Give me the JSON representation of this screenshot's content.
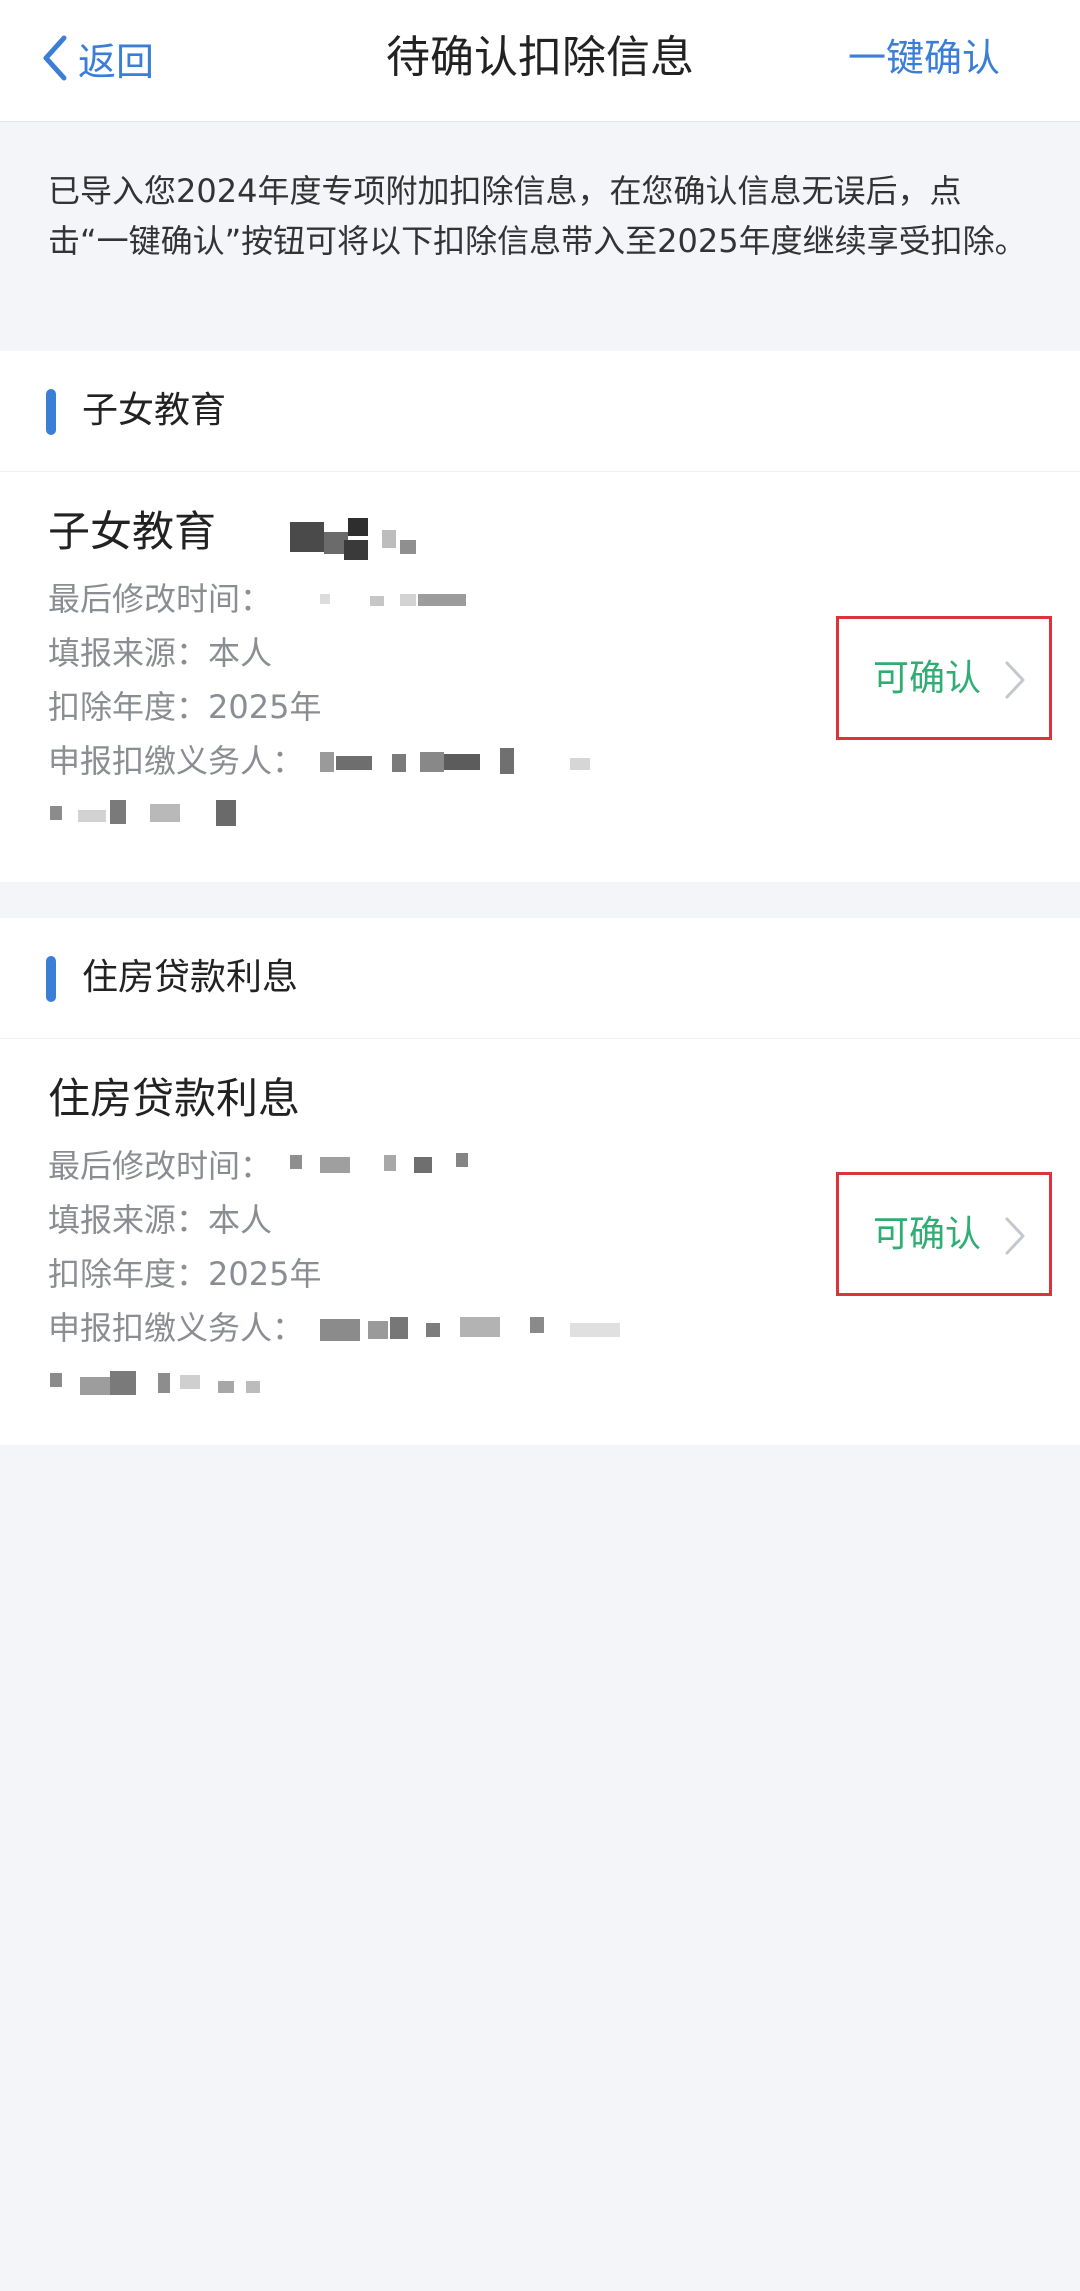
{
  "nav": {
    "back_label": "返回",
    "title": "待确认扣除信息",
    "confirm_all_label": "一键确认"
  },
  "notice": "已导入您2024年度专项附加扣除信息，在您确认信息无误后，点击“一键确认”按钮可将以下扣除信息带入至2025年度继续享受扣除。",
  "sections": [
    {
      "header": "子女教育",
      "card": {
        "name": "子女教育",
        "last_modified_label": "最后修改时间：",
        "source": "填报来源：本人",
        "year": "扣除年度：2025年",
        "agent_label": "申报扣缴义务人：",
        "status": "可确认"
      }
    },
    {
      "header": "住房贷款利息",
      "card": {
        "name": "住房贷款利息",
        "last_modified_label": "最后修改时间：",
        "source": "填报来源：本人",
        "year": "扣除年度：2025年",
        "agent_label": "申报扣缴义务人：",
        "status": "可确认"
      }
    }
  ],
  "colors": {
    "accent": "#3b7ed8",
    "status_green": "#2fae73",
    "highlight_red": "#d9353a",
    "background": "#f3f5f9"
  }
}
